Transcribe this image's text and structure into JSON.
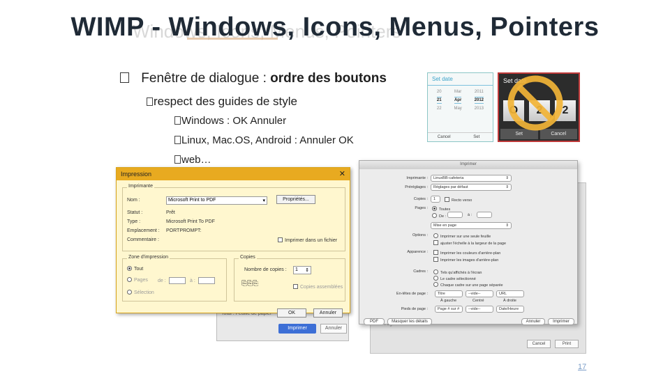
{
  "slide": {
    "title": "WIMP - Windows, Icons, Menus, Pointers",
    "page_number": "17"
  },
  "bullets": {
    "main": {
      "prefix": "Fenêtre de dialogue : ",
      "bold": "ordre des boutons"
    },
    "sub": "respect des guides de style",
    "items": [
      "Windows : OK Annuler",
      "Linux, Mac.OS, Android : Annuler OK",
      "web…"
    ]
  },
  "android_ok": {
    "header": "Set date",
    "columns": [
      [
        "20",
        "21",
        "22"
      ],
      [
        "Mar",
        "Apr",
        "May"
      ],
      [
        "2011",
        "2012",
        "2013"
      ]
    ],
    "cancel": "Cancel",
    "set": "Set"
  },
  "android_bad": {
    "header": "Set date",
    "digits": [
      "O",
      "2",
      "2"
    ],
    "set": "Set",
    "cancel": "Cancel"
  },
  "win_dialog": {
    "title": "Impression",
    "printer_group": "Imprimante",
    "name_label": "Nom :",
    "name_value": "Microsoft Print to PDF",
    "properties_button": "Propriétés...",
    "status_label": "Statut :",
    "status_value": "Prêt",
    "type_label": "Type :",
    "type_value": "Microsoft Print To PDF",
    "location_label": "Emplacement :",
    "location_value": "PORTPROMPT:",
    "comment_label": "Commentaire :",
    "print_to_file": "Imprimer dans un fichier",
    "range_group": "Zone d'impression",
    "all": "Tout",
    "pages": "Pages",
    "from": "de :",
    "to": "à :",
    "selection": "Sélection",
    "copies_group": "Copies",
    "copies_label": "Nombre de copies :",
    "copies_value": "1",
    "collate": "Copies assemblées",
    "ok": "OK",
    "cancel": "Annuler"
  },
  "mac_dialog": {
    "title": "Imprimer",
    "printer_label": "Imprimante :",
    "printer_value": "LinuxBB-cafeteria",
    "presets_label": "Préréglages :",
    "presets_value": "Réglages par défaut",
    "copies_label": "Copies :",
    "copies_value": "1",
    "reverse": "Recto verso",
    "pages_label": "Pages :",
    "all": "Toutes",
    "from": "De :",
    "to": "à :",
    "menu_value": "Mise en page",
    "options_label": "Options :",
    "option1": "Imprimer sur une seule feuille",
    "option2": "ajuster l'échelle à la largeur de la page",
    "appearance_label": "Apparence :",
    "appearance1": "Imprimer les couleurs d'arrière-plan",
    "appearance2": "Imprimer les images d'arrière-plan",
    "frames_label": "Cadres :",
    "frames1": "Tels qu'affichés à l'écran",
    "frames2": "Le cadre sélectionné",
    "frames3": "Chaque cadre sur une page séparée",
    "headers_label": "En-têtes de page :",
    "footers_label": "Pieds de page :",
    "header_values": [
      "Titre",
      "--vide--",
      "URL"
    ],
    "footer_values": [
      "Page # sur #",
      "--vide--",
      "Date/Heure"
    ],
    "pos_labels": [
      "À gauche",
      "Centré",
      "À droite"
    ],
    "pdf_button": "PDF",
    "details_button": "Masquer les détails",
    "cancel": "Annuler",
    "print": "Imprimer"
  },
  "behind_dialogs": {
    "win_back_label": "Total : Feuille de papier",
    "win_back_print": "Imprimer",
    "win_back_cancel": "Annuler",
    "mac_back_pages": "Pages",
    "mac_back_cancel": "Cancel",
    "mac_back_print": "Print"
  }
}
